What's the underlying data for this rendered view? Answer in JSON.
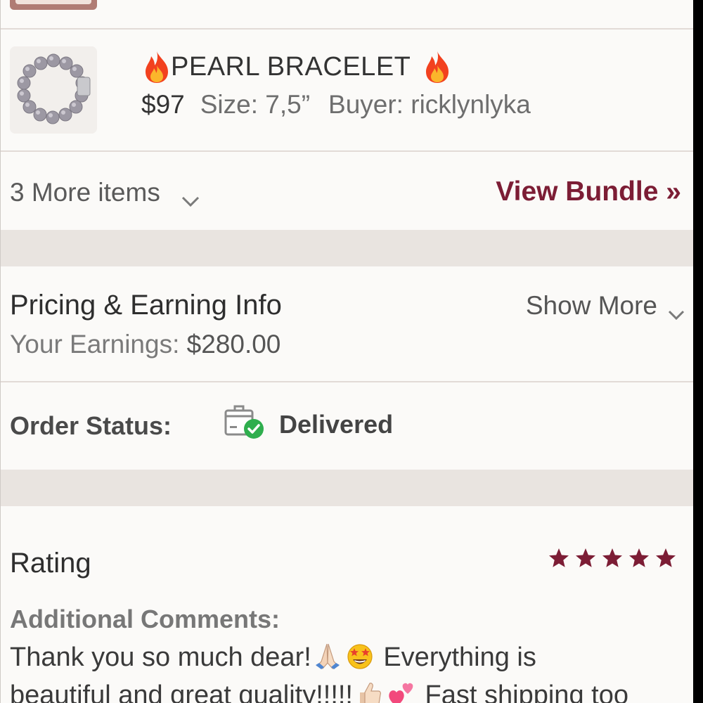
{
  "item": {
    "title": "PEARL BRACELET",
    "price": "$97",
    "size": "Size: 7,5”",
    "buyer": "Buyer: ricklynlyka",
    "title_icon": "fire-icon",
    "thumbnail_icon": "pearl-bracelet-photo"
  },
  "bundle": {
    "more_items": "3 More items",
    "view_bundle": "View Bundle »"
  },
  "pricing": {
    "title": "Pricing & Earning Info",
    "show_more": "Show More",
    "earnings_label": "Your Earnings:",
    "earnings_value": "$280.00"
  },
  "order": {
    "status_label": "Order Status:",
    "status_value": "Delivered",
    "status_icon": "package-delivered-icon"
  },
  "rating": {
    "title": "Rating",
    "stars": 5,
    "star_color": "#7c1d35",
    "comments_label": "Additional Comments:",
    "comment_line1_a": "Thank you so much dear!",
    "comment_line1_b": " Everything is",
    "comment_line2_a": "beautiful and great quality!!!!!",
    "comment_line2_b": " Fast shipping too"
  },
  "colors": {
    "accent": "#7c1d35",
    "background": "#fbfaf8",
    "separator_band": "#e9e4e0",
    "success": "#2fae4e"
  }
}
